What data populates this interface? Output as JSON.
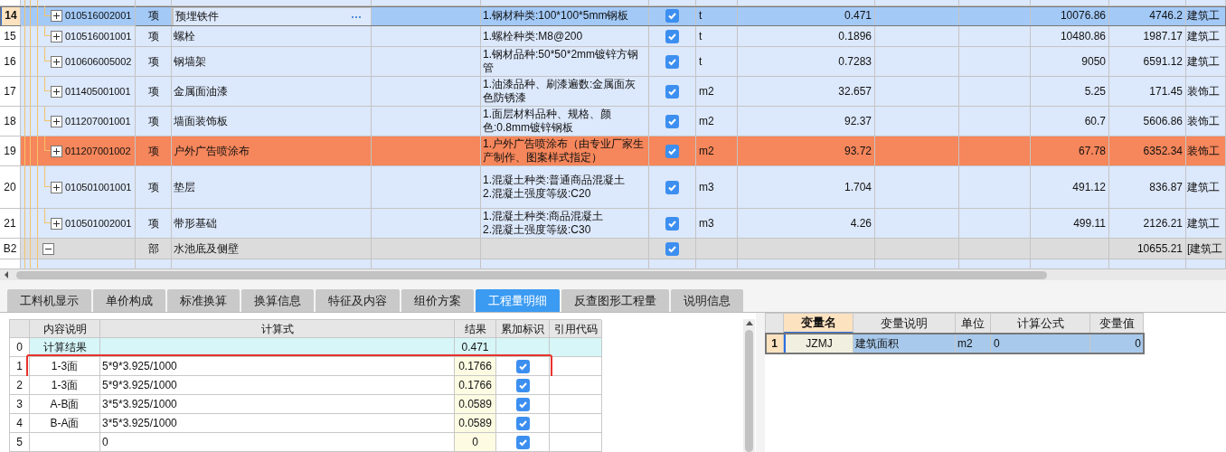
{
  "top_table": {
    "rows": [
      {
        "kind": "item",
        "number": "14",
        "code": "010516002001",
        "type": "项",
        "name": "预埋铁件",
        "features": [
          "1.钢材种类:100*100*5mm钢板"
        ],
        "included": true,
        "unit": "t",
        "quantity": "0.471",
        "price": "10076.86",
        "total": "4746.2",
        "category": "建筑工",
        "selected": true,
        "flagged": false
      },
      {
        "kind": "item",
        "number": "15",
        "code": "010516001001",
        "type": "项",
        "name": "螺栓",
        "features": [
          "1.螺栓种类:M8@200"
        ],
        "included": true,
        "unit": "t",
        "quantity": "0.1896",
        "price": "10480.86",
        "total": "1987.17",
        "category": "建筑工",
        "selected": false,
        "flagged": false
      },
      {
        "kind": "item",
        "number": "16",
        "code": "010606005002",
        "type": "项",
        "name": "钢墙架",
        "features": [
          "1.钢材品种:50*50*2mm镀锌方钢管"
        ],
        "included": true,
        "unit": "t",
        "quantity": "0.7283",
        "price": "9050",
        "total": "6591.12",
        "category": "建筑工",
        "selected": false,
        "flagged": false
      },
      {
        "kind": "item",
        "number": "17",
        "code": "011405001001",
        "type": "项",
        "name": "金属面油漆",
        "features": [
          "1.油漆品种、刷漆遍数:金属面灰色防锈漆"
        ],
        "included": true,
        "unit": "m2",
        "quantity": "32.657",
        "price": "5.25",
        "total": "171.45",
        "category": "装饰工",
        "selected": false,
        "flagged": false
      },
      {
        "kind": "item",
        "number": "18",
        "code": "011207001001",
        "type": "项",
        "name": "墙面装饰板",
        "features": [
          "1.面层材料品种、规格、颜色:0.8mm镀锌钢板"
        ],
        "included": true,
        "unit": "m2",
        "quantity": "92.37",
        "price": "60.7",
        "total": "5606.86",
        "category": "装饰工",
        "selected": false,
        "flagged": false
      },
      {
        "kind": "item",
        "number": "19",
        "code": "011207001002",
        "type": "项",
        "name": "户外广告喷涂布",
        "features": [
          "1.户外广告喷涂布（由专业厂家生产制作、图案样式指定）"
        ],
        "included": true,
        "unit": "m2",
        "quantity": "93.72",
        "price": "67.78",
        "total": "6352.34",
        "category": "装饰工",
        "selected": false,
        "flagged": true
      },
      {
        "kind": "item",
        "number": "20",
        "code": "010501001001",
        "type": "项",
        "name": "垫层",
        "features": [
          "1.混凝土种类:普通商品混凝土",
          "2.混凝土强度等级:C20"
        ],
        "included": true,
        "unit": "m3",
        "quantity": "1.704",
        "price": "491.12",
        "total": "836.87",
        "category": "建筑工",
        "selected": false,
        "flagged": false
      },
      {
        "kind": "item",
        "number": "21",
        "code": "010501002001",
        "type": "项",
        "name": "带形基础",
        "features": [
          "1.混凝土种类:商品混凝土",
          "2.混凝土强度等级:C30"
        ],
        "included": true,
        "unit": "m3",
        "quantity": "4.26",
        "price": "499.11",
        "total": "2126.21",
        "category": "建筑工",
        "selected": false,
        "flagged": false
      },
      {
        "kind": "section",
        "number": "B2",
        "expanded": true,
        "type": "部",
        "name": "水池底及侧壁",
        "included": true,
        "total": "10655.21",
        "category": "[建筑工",
        "selected": false,
        "flagged": false
      }
    ]
  },
  "tabs": [
    {
      "label": "工料机显示",
      "selected": false
    },
    {
      "label": "单价构成",
      "selected": false
    },
    {
      "label": "标准换算",
      "selected": false
    },
    {
      "label": "换算信息",
      "selected": false
    },
    {
      "label": "特征及内容",
      "selected": false
    },
    {
      "label": "组价方案",
      "selected": false
    },
    {
      "label": "工程量明细",
      "selected": true
    },
    {
      "label": "反查图形工程量",
      "selected": false
    },
    {
      "label": "说明信息",
      "selected": false
    }
  ],
  "quantity_table": {
    "columns": [
      "内容说明",
      "计算式",
      "结果",
      "累加标识",
      "引用代码"
    ],
    "rows": [
      {
        "kind": "total",
        "number": "0",
        "description": "计算结果",
        "formula": "",
        "result": "0.471",
        "highlighted": false
      },
      {
        "kind": "detail",
        "number": "1",
        "description": "1-3面",
        "formula": "5*9*3.925/1000",
        "result": "0.1766",
        "accumulate": true,
        "highlighted": true
      },
      {
        "kind": "detail",
        "number": "2",
        "description": "1-3面",
        "formula": "5*9*3.925/1000",
        "result": "0.1766",
        "accumulate": true,
        "highlighted": false
      },
      {
        "kind": "detail",
        "number": "3",
        "description": "A-B面",
        "formula": "3*5*3.925/1000",
        "result": "0.0589",
        "accumulate": true,
        "highlighted": false
      },
      {
        "kind": "detail",
        "number": "4",
        "description": "B-A面",
        "formula": "3*5*3.925/1000",
        "result": "0.0589",
        "accumulate": true,
        "highlighted": false
      },
      {
        "kind": "detail",
        "number": "5",
        "description": "",
        "formula": "0",
        "result": "0",
        "accumulate": true,
        "highlighted": false
      }
    ]
  },
  "variable_table": {
    "columns": [
      "变量名",
      "变量说明",
      "单位",
      "计算公式",
      "变量值"
    ],
    "rows": [
      {
        "number": "1",
        "name": "JZMJ",
        "description": "建筑面积",
        "unit": "m2",
        "formula": "0",
        "value": "0",
        "selected": true
      }
    ]
  }
}
